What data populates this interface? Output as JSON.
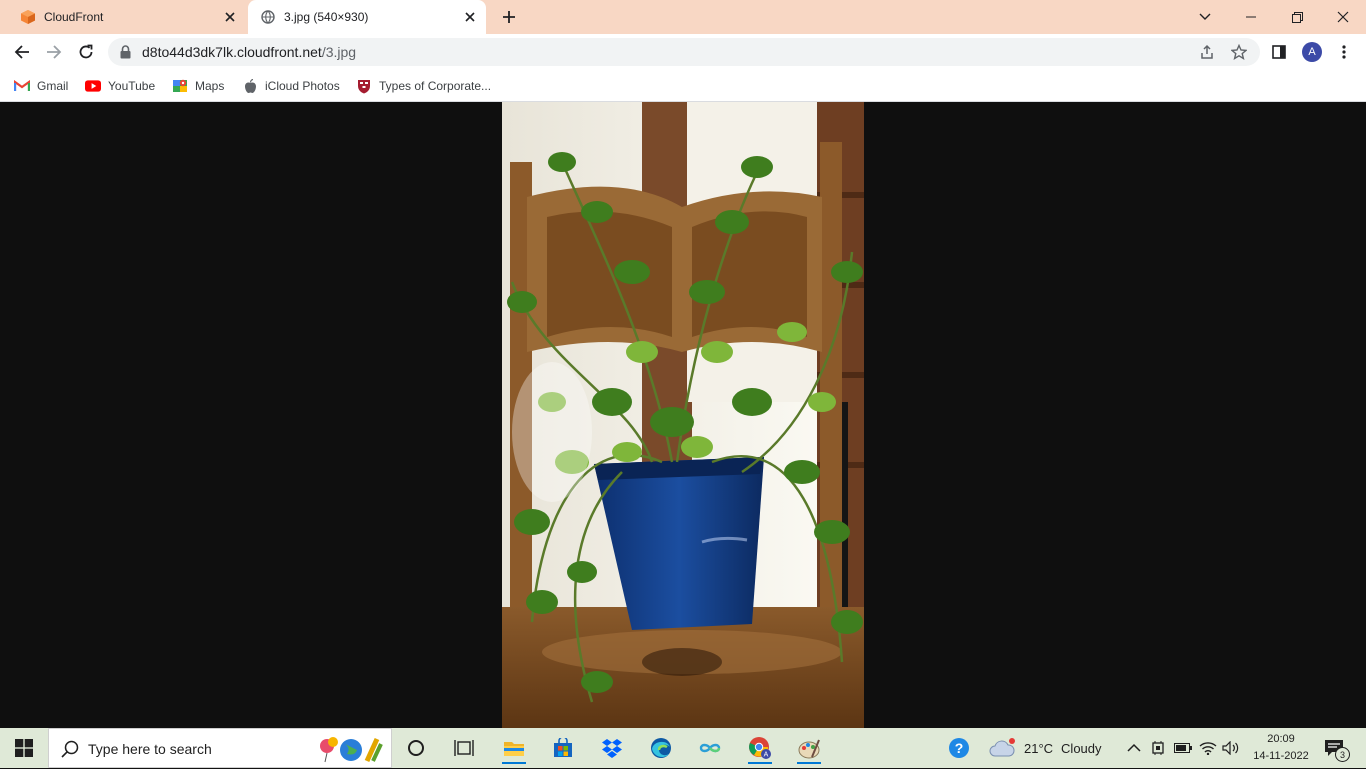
{
  "browser": {
    "tabs": [
      {
        "label": "CloudFront",
        "active": false
      },
      {
        "label": "3.jpg (540×930)",
        "active": true
      }
    ],
    "address": {
      "host": "d8to44d3dk7lk.cloudfront.net",
      "path": "/3.jpg"
    },
    "profile_initial": "A",
    "bookmarks": [
      {
        "label": "Gmail",
        "icon": "gmail-icon"
      },
      {
        "label": "YouTube",
        "icon": "youtube-icon"
      },
      {
        "label": "Maps",
        "icon": "maps-icon"
      },
      {
        "label": "iCloud Photos",
        "icon": "apple-icon"
      },
      {
        "label": "Types of Corporate...",
        "icon": "shield-crest-icon"
      }
    ]
  },
  "viewer": {
    "image_alt": "Potted pothos plant on wooden chair"
  },
  "taskbar": {
    "search_placeholder": "Type here to search",
    "weather": {
      "temp": "21°C",
      "condition": "Cloudy"
    },
    "time": "20:09",
    "date": "14-11-2022",
    "notification_count": "3"
  },
  "colors": {
    "tabstrip": "#f8d7c4",
    "taskbar": "#dfe9d7",
    "viewer_bg": "#0f0f0f",
    "accent": "#0078d4"
  }
}
